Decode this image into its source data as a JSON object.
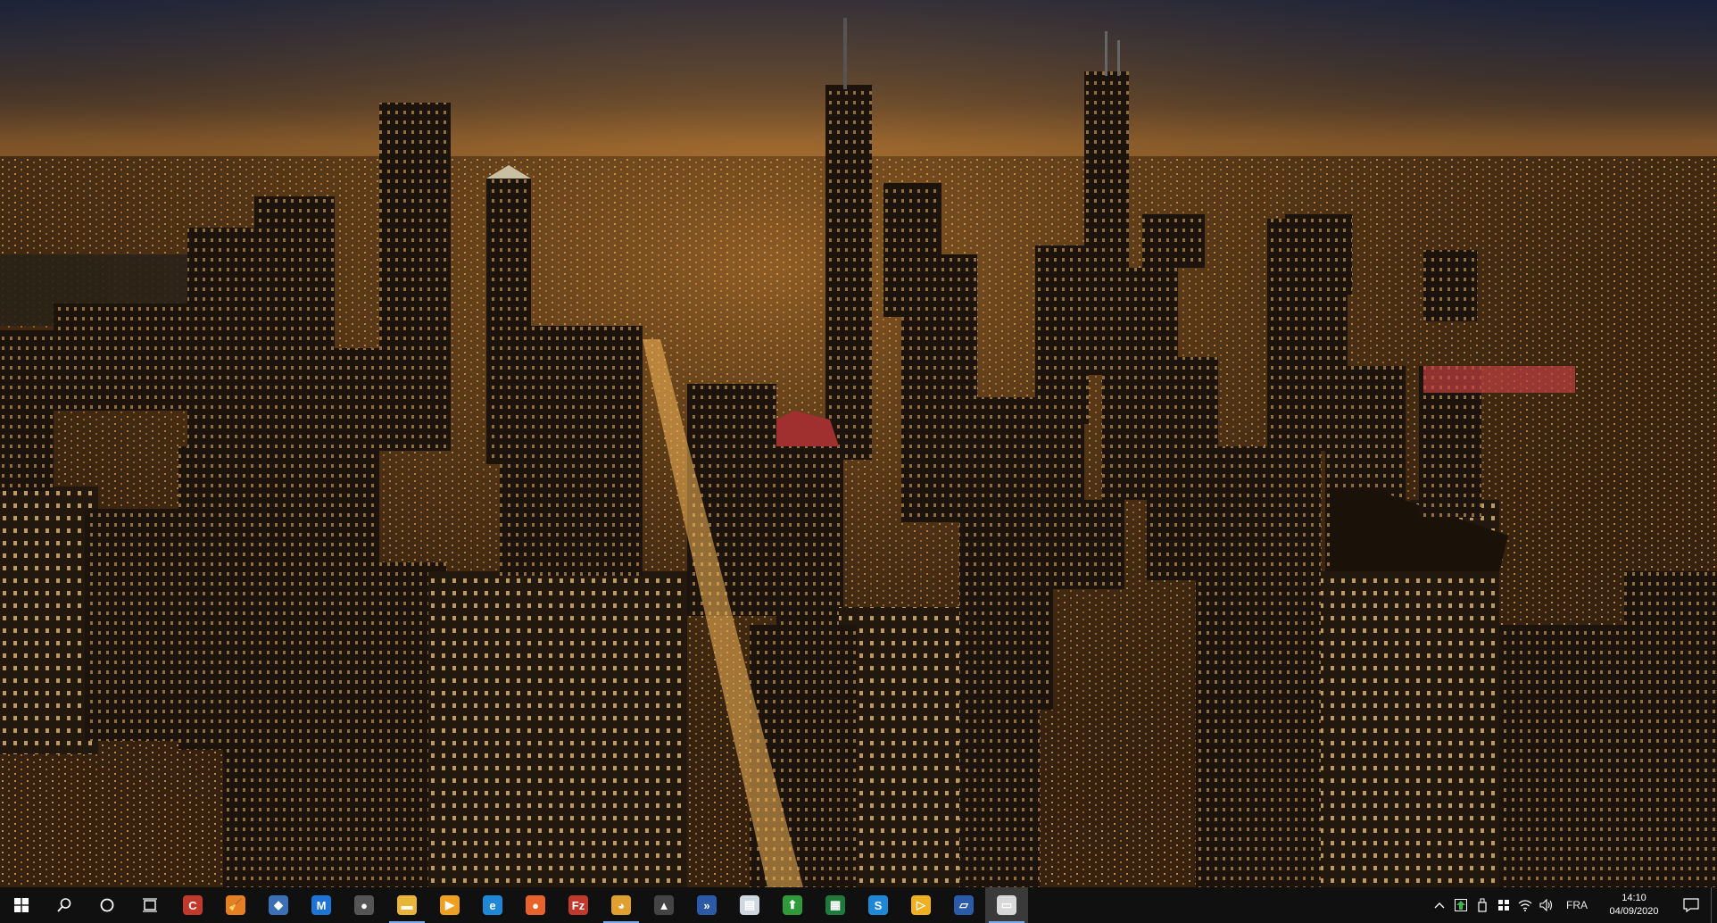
{
  "wallpaper": {
    "description_icon": "city-night-wallpaper",
    "sky_color": "#0d1430",
    "glow_color": "#f0a040"
  },
  "taskbar": {
    "start_icon": "windows-logo-icon",
    "search_icon": "search-icon",
    "cortana_icon": "cortana-circle-icon",
    "taskview_icon": "task-view-icon",
    "apps": [
      {
        "id": "ccleaner",
        "icon": "ccleaner-icon",
        "glyph": "C",
        "color": "#c0392b",
        "active": false
      },
      {
        "id": "cleaner-broom",
        "icon": "broom-icon",
        "glyph": "🧹",
        "color": "#e67e22",
        "active": false
      },
      {
        "id": "robot-app",
        "icon": "robot-icon",
        "glyph": "◆",
        "color": "#3b6fb6",
        "active": false
      },
      {
        "id": "malwarebytes",
        "icon": "malwarebytes-icon",
        "glyph": "M",
        "color": "#1e73d8",
        "active": false
      },
      {
        "id": "game-controller",
        "icon": "controller-icon",
        "glyph": "●",
        "color": "#555",
        "active": false
      },
      {
        "id": "file-explorer",
        "icon": "folder-icon",
        "glyph": "▬",
        "color": "#e8b53a",
        "active": true
      },
      {
        "id": "media-player",
        "icon": "media-player-icon",
        "glyph": "▶",
        "color": "#f0a020",
        "active": false
      },
      {
        "id": "edge",
        "icon": "edge-icon",
        "glyph": "e",
        "color": "#1e88d6",
        "active": false
      },
      {
        "id": "firefox",
        "icon": "firefox-icon",
        "glyph": "●",
        "color": "#e8622c",
        "active": false
      },
      {
        "id": "filezilla",
        "icon": "filezilla-icon",
        "glyph": "Fz",
        "color": "#c0392b",
        "active": false
      },
      {
        "id": "paint-app",
        "icon": "palette-icon",
        "glyph": "◕",
        "color": "#e0a030",
        "active": true
      },
      {
        "id": "inkscape",
        "icon": "inkscape-icon",
        "glyph": "▲",
        "color": "#444",
        "active": false
      },
      {
        "id": "terminal-app",
        "icon": "terminal-icon",
        "glyph": "»",
        "color": "#2a5aa8",
        "active": false
      },
      {
        "id": "notepad",
        "icon": "document-icon",
        "glyph": "▤",
        "color": "#cfd8e0",
        "active": false
      },
      {
        "id": "upload-app",
        "icon": "upload-arrow-icon",
        "glyph": "⬆",
        "color": "#2e9a3a",
        "active": false
      },
      {
        "id": "spreadsheet",
        "icon": "spreadsheet-icon",
        "glyph": "▦",
        "color": "#1d7a3a",
        "active": false
      },
      {
        "id": "skype-like",
        "icon": "s-circle-icon",
        "glyph": "S",
        "color": "#1e88d6",
        "active": false
      },
      {
        "id": "presenter",
        "icon": "presenter-icon",
        "glyph": "▷",
        "color": "#f0b020",
        "active": false
      },
      {
        "id": "note-app",
        "icon": "note-icon",
        "glyph": "▱",
        "color": "#2a5aa8",
        "active": false
      },
      {
        "id": "remote-desktop",
        "icon": "monitor-icon",
        "glyph": "▭",
        "color": "#d8d8d8",
        "active": true,
        "focused": true
      }
    ],
    "tray": {
      "chevron_icon": "chevron-up-icon",
      "icons": [
        "upload-arrow-tray-icon",
        "usb-drive-icon",
        "shield-flag-icon",
        "wifi-icon",
        "volume-icon"
      ],
      "language": "FRA",
      "time": "14:10",
      "date": "04/09/2020",
      "notification_icon": "notification-icon"
    }
  }
}
